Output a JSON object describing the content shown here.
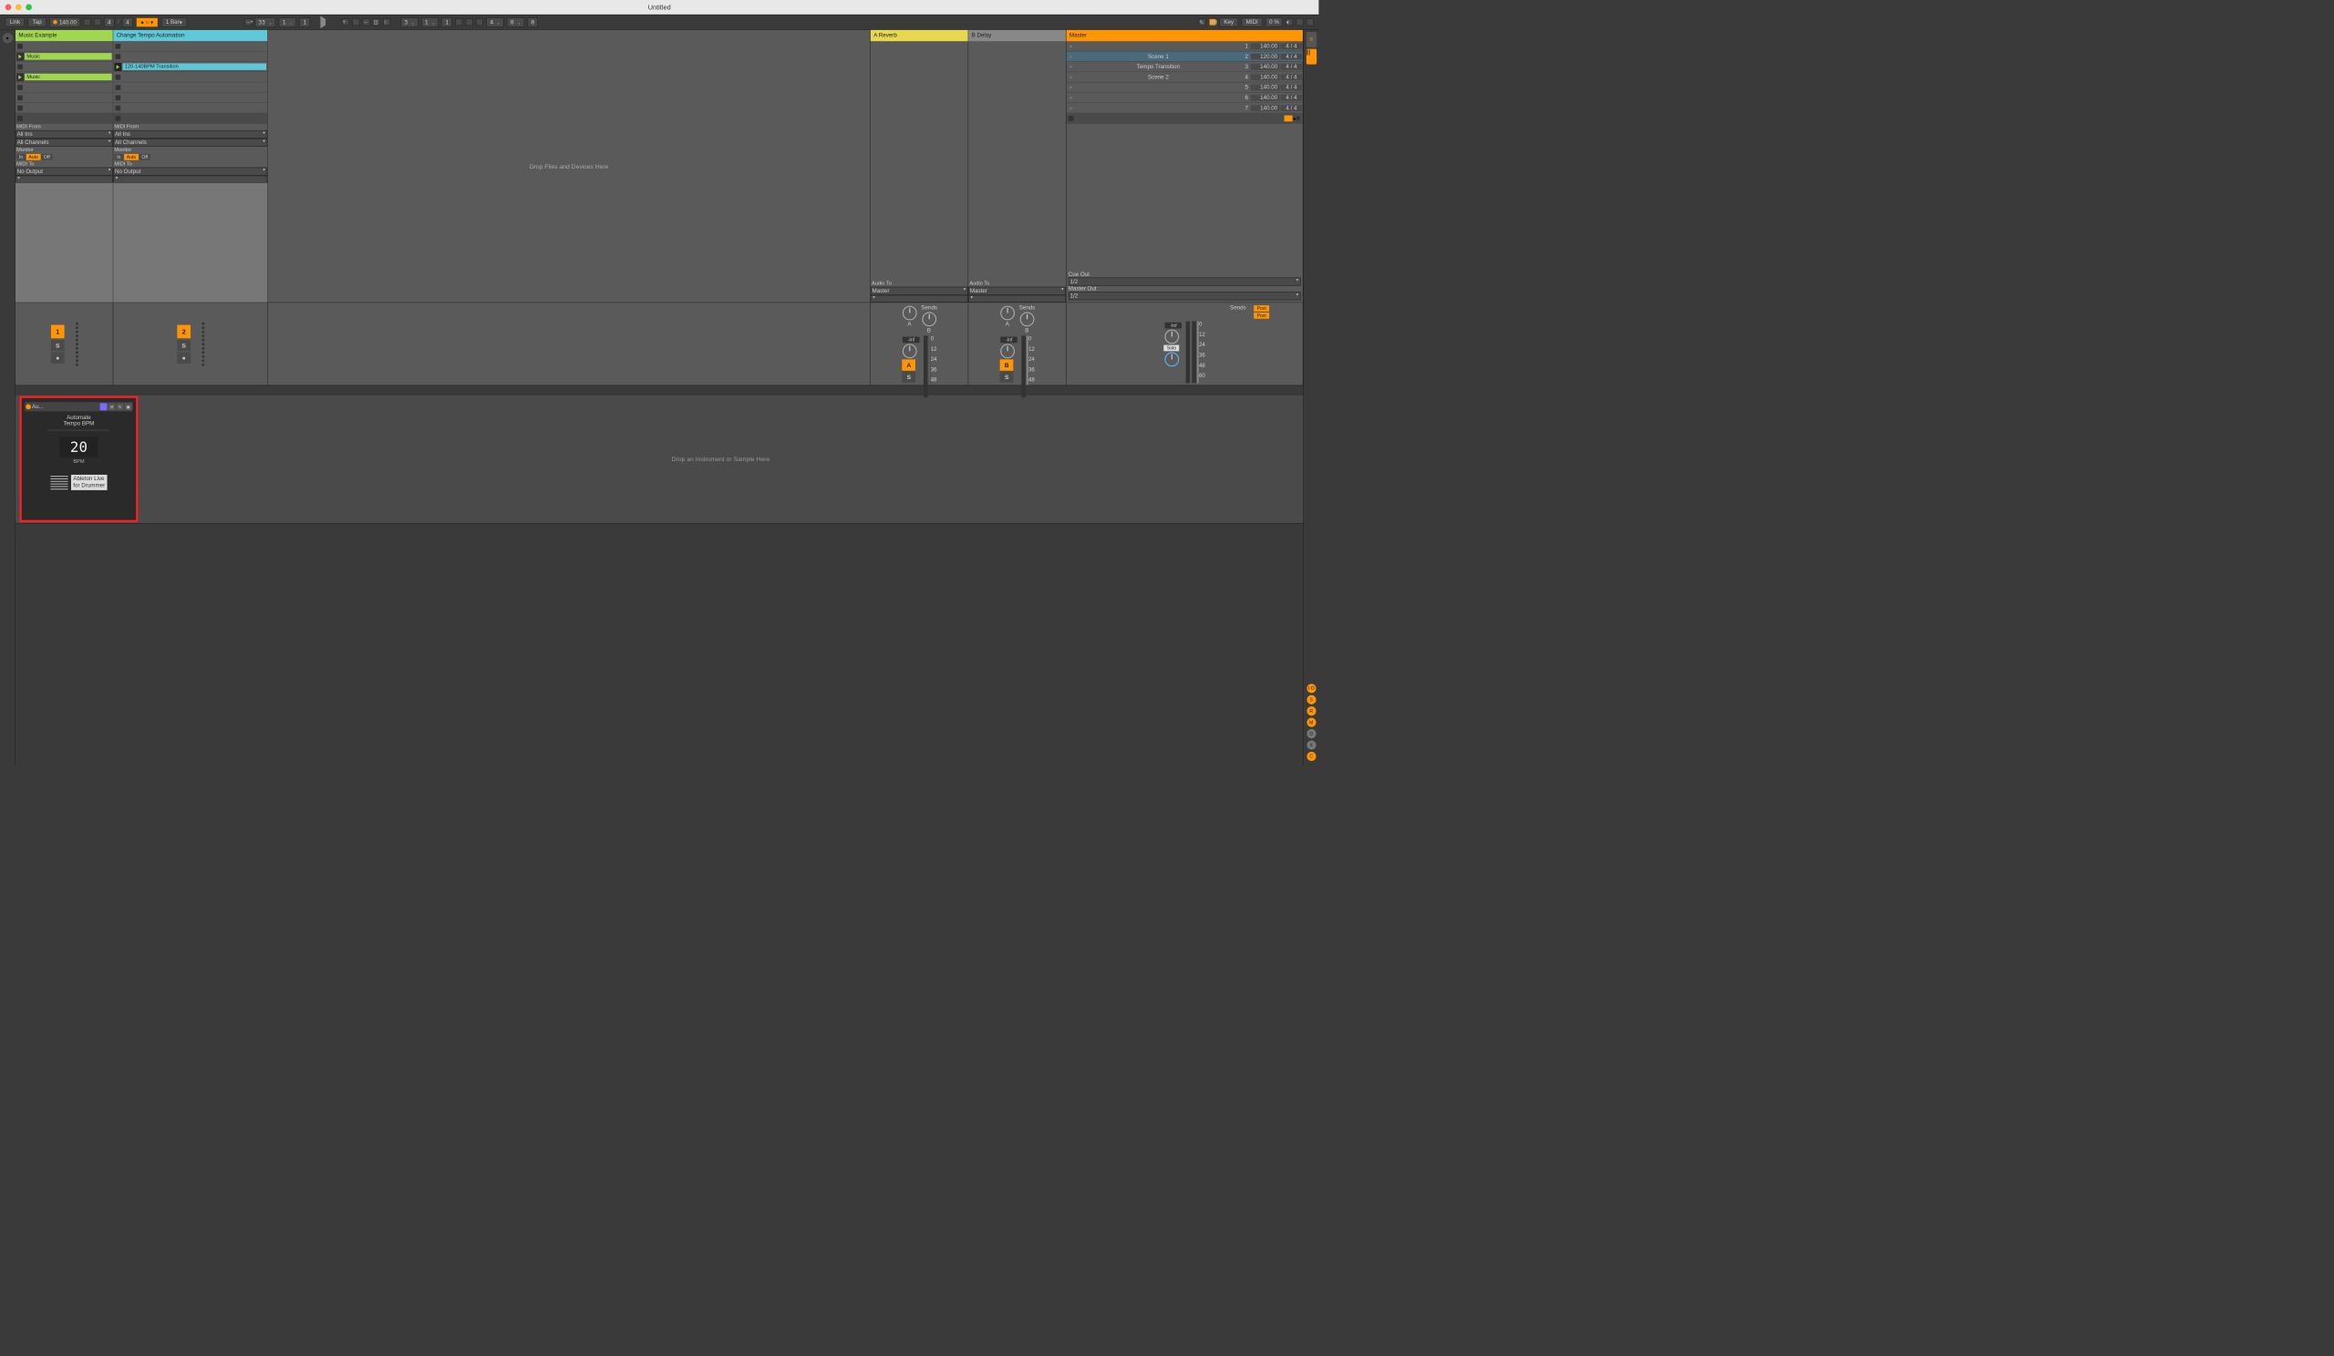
{
  "window": {
    "title": "Untitled"
  },
  "toolbar": {
    "link": "Link",
    "tap": "Tap",
    "tempo": "140.00",
    "sig_num": "4",
    "sig_den": "4",
    "quantize": "1 Bar",
    "bar_pos": "33 .",
    "beat_pos": "1 .",
    "sub_pos": "1",
    "loop_bar": "3 .",
    "loop_beat": "1 .",
    "loop_sub": "1",
    "len_bar": "4 .",
    "len_beat": "0 .",
    "len_sub": "0",
    "key": "Key",
    "midi": "MIDI",
    "cpu": "0 %"
  },
  "tracks": [
    {
      "name": "Music Example",
      "color": "hdr-green",
      "clips": [
        "",
        "Music",
        "",
        "Music",
        "",
        ""
      ],
      "midi_from": "MIDI From",
      "all_ins": "All Ins",
      "all_ch": "All Channels",
      "monitor": "Monitor",
      "in": "In",
      "auto": "Auto",
      "off": "Off",
      "midi_to": "MIDI To",
      "no_out": "No Output",
      "num": "1"
    },
    {
      "name": "Change Tempo Automation",
      "color": "hdr-cyan",
      "clips": [
        "",
        "",
        "120-140BPM Transition",
        "",
        "",
        ""
      ],
      "midi_from": "MIDI From",
      "all_ins": "All Ins",
      "all_ch": "All Channels",
      "monitor": "Monitor",
      "in": "In",
      "auto": "Auto",
      "off": "Off",
      "midi_to": "MIDI To",
      "no_out": "No Output",
      "num": "2"
    }
  ],
  "drop_clips": "Drop Files and Devices Here",
  "returns": [
    {
      "name": "A Reverb",
      "audio_to": "Audio To",
      "dest": "Master",
      "sends": "Sends",
      "letter": "A",
      "inf": "-Inf"
    },
    {
      "name": "B Delay",
      "audio_to": "Audio To",
      "dest": "Master",
      "sends": "Sends",
      "letter": "B",
      "inf": "-Inf"
    }
  ],
  "master": {
    "name": "Master",
    "cue_out": "Cue Out",
    "cue_val": "1/2",
    "master_out": "Master Out",
    "master_val": "1/2",
    "sends": "Sends",
    "post": "Post",
    "solo": "Solo",
    "inf": "-Inf"
  },
  "scenes": [
    {
      "name": "",
      "num": "1",
      "tempo": "140.00",
      "sig": "4 / 4"
    },
    {
      "name": "Scene 1",
      "num": "2",
      "tempo": "120.00",
      "sig": "4 / 4",
      "hl": true
    },
    {
      "name": "Tempo Transition",
      "num": "3",
      "tempo": "140.00",
      "sig": "4 / 4"
    },
    {
      "name": "Scene 2",
      "num": "4",
      "tempo": "140.00",
      "sig": "4 / 4"
    },
    {
      "name": "",
      "num": "5",
      "tempo": "140.00",
      "sig": "4 / 4"
    },
    {
      "name": "",
      "num": "6",
      "tempo": "140.00",
      "sig": "4 / 4"
    },
    {
      "name": "",
      "num": "7",
      "tempo": "140.00",
      "sig": "4 / 4"
    }
  ],
  "meter_ticks": [
    "0",
    "12",
    "24",
    "36",
    "48",
    "60"
  ],
  "s_label": "S",
  "device": {
    "name": "Au...",
    "title1": "Automate",
    "title2": "Tempo BPM",
    "value": "20",
    "unit": "BPM",
    "logo1": "Ableton Live",
    "logo2": "for Drummer"
  },
  "drop_device": "Drop an Instrument or Sample Here",
  "right_buttons": [
    "I·O",
    "S",
    "R",
    "M",
    "D",
    "X",
    "C"
  ]
}
